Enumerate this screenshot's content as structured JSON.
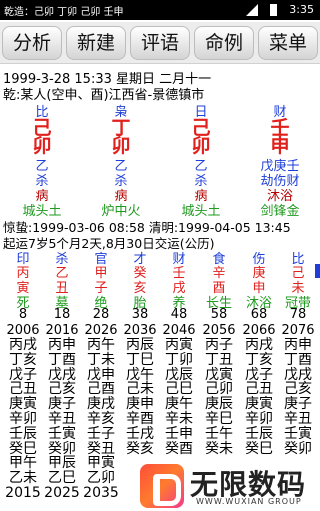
{
  "status": {
    "left": "乾造：己卯 丁卯 己卯 壬申",
    "time": "3:35"
  },
  "toolbar": [
    "分析",
    "新建",
    "评语",
    "命例",
    "菜单"
  ],
  "info": {
    "line1": "1999-3-28 15:33  星期日  二月十一",
    "line2": "乾:某人(空申、酉)江西省-景德镇市"
  },
  "pillars": [
    {
      "god": "比",
      "stem": "己",
      "branch": "卯",
      "hidden": [
        "乙",
        "杀"
      ],
      "state": "病",
      "nayin": "城头土"
    },
    {
      "god": "枭",
      "stem": "丁",
      "branch": "卯",
      "hidden": [
        "乙",
        "杀"
      ],
      "state": "病",
      "nayin": "炉中火"
    },
    {
      "god": "日",
      "stem": "己",
      "branch": "卯",
      "hidden": [
        "乙",
        "杀"
      ],
      "state": "病",
      "nayin": "城头土"
    },
    {
      "god": "财",
      "stem": "壬",
      "branch": "申",
      "hidden": [
        "戊庚壬",
        "劫伤财"
      ],
      "state": "沐浴",
      "nayin": "剑锋金"
    }
  ],
  "jieqi": "惊蛰:1999-03-06 08:58  清明:1999-04-05 13:45",
  "qiyun": "起运7岁5个月2天,8月30日交运(公历)",
  "dayun": [
    {
      "god": "印",
      "stem": "丙",
      "branch": "寅",
      "state": "死",
      "age": "8",
      "year": "2006",
      "flow": [
        "丙戌",
        "丁亥",
        "戊子",
        "己丑",
        "庚寅",
        "辛卯",
        "壬辰",
        "癸巳",
        "甲午",
        "乙未"
      ],
      "end": "2015"
    },
    {
      "god": "杀",
      "stem": "乙",
      "branch": "丑",
      "state": "墓",
      "age": "18",
      "year": "2016",
      "flow": [
        "丙申",
        "丁酉",
        "戊戌",
        "己亥",
        "庚子",
        "辛丑",
        "壬寅",
        "癸卯",
        "甲辰",
        "乙巳"
      ],
      "end": "2025"
    },
    {
      "god": "官",
      "stem": "甲",
      "branch": "子",
      "state": "绝",
      "age": "28",
      "year": "2026",
      "flow": [
        "丙午",
        "丁未",
        "戊申",
        "己酉",
        "庚戌",
        "辛亥",
        "壬子",
        "癸丑",
        "甲寅",
        "乙卯"
      ],
      "end": "2035"
    },
    {
      "god": "才",
      "stem": "癸",
      "branch": "亥",
      "state": "胎",
      "age": "38",
      "year": "2036",
      "flow": [
        "丙辰",
        "丁巳",
        "戊午",
        "己未",
        "庚申",
        "辛酉",
        "壬戌",
        "癸亥",
        "",
        ""
      ],
      "end": ""
    },
    {
      "god": "财",
      "stem": "壬",
      "branch": "戌",
      "state": "养",
      "age": "48",
      "year": "2046",
      "flow": [
        "丙寅",
        "丁卯",
        "戊辰",
        "己巳",
        "庚午",
        "辛未",
        "壬申",
        "癸酉",
        "",
        ""
      ],
      "end": ""
    },
    {
      "god": "食",
      "stem": "辛",
      "branch": "酉",
      "state": "长生",
      "age": "58",
      "year": "2056",
      "flow": [
        "丙子",
        "丁丑",
        "戊寅",
        "己卯",
        "庚辰",
        "辛巳",
        "壬午",
        "癸未",
        "",
        ""
      ],
      "end": ""
    },
    {
      "god": "伤",
      "stem": "庚",
      "branch": "申",
      "state": "沐浴",
      "age": "68",
      "year": "2066",
      "flow": [
        "丙戌",
        "丁亥",
        "戊子",
        "己丑",
        "庚寅",
        "辛卯",
        "壬辰",
        "癸巳",
        "",
        ""
      ],
      "end": ""
    },
    {
      "god": "比",
      "stem": "己",
      "branch": "未",
      "state": "冠带",
      "age": "78",
      "year": "2076",
      "flow": [
        "丙申",
        "丁酉",
        "戊戌",
        "己亥",
        "庚子",
        "辛丑",
        "壬寅",
        "癸卯",
        "",
        ""
      ],
      "end": ""
    }
  ],
  "watermark": {
    "cn": "无限数码",
    "en": "WWW.WUXIAN GROUP"
  }
}
